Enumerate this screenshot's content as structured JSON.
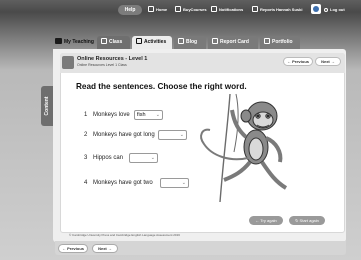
{
  "topnav": {
    "help": "Help",
    "home": "Home",
    "buy_courses": "BuyCourses",
    "notifications": "Notifications",
    "reports": "Reports",
    "user": "Hannah Suski",
    "logout": "Log out"
  },
  "tabs": {
    "my_teaching": "My Teaching",
    "class": "Class",
    "activities": "Activities",
    "blog": "Blog",
    "report_card": "Report Card",
    "portfolio": "Portfolio"
  },
  "sidebar": {
    "content_label": "Content"
  },
  "header": {
    "title": "Online Resources - Level 1",
    "subtitle": "Online Resources Level 1 Class",
    "previous_button": "Previous",
    "next_button": "Next"
  },
  "exercise": {
    "instruction": "Read the sentences. Choose the right word.",
    "questions": [
      {
        "number": "1",
        "text": "Monkeys love",
        "selected": "fish"
      },
      {
        "number": "2",
        "text": "Monkeys have got long",
        "selected": ""
      },
      {
        "number": "3",
        "text": "Hippos can",
        "selected": ""
      },
      {
        "number": "4",
        "text": "Monkeys have got two",
        "selected": ""
      }
    ],
    "try_again": "Try again",
    "start_again": "Start again",
    "copyright": "© Cambridge University Press and Cambridge English Language Assessment 2016"
  },
  "footer": {
    "previous_button": "Previous",
    "next_button": "Next"
  },
  "colors": {
    "tab_dark": "#6f6f6f",
    "panel_bg": "#efefef",
    "card_bg": "#ffffff"
  }
}
